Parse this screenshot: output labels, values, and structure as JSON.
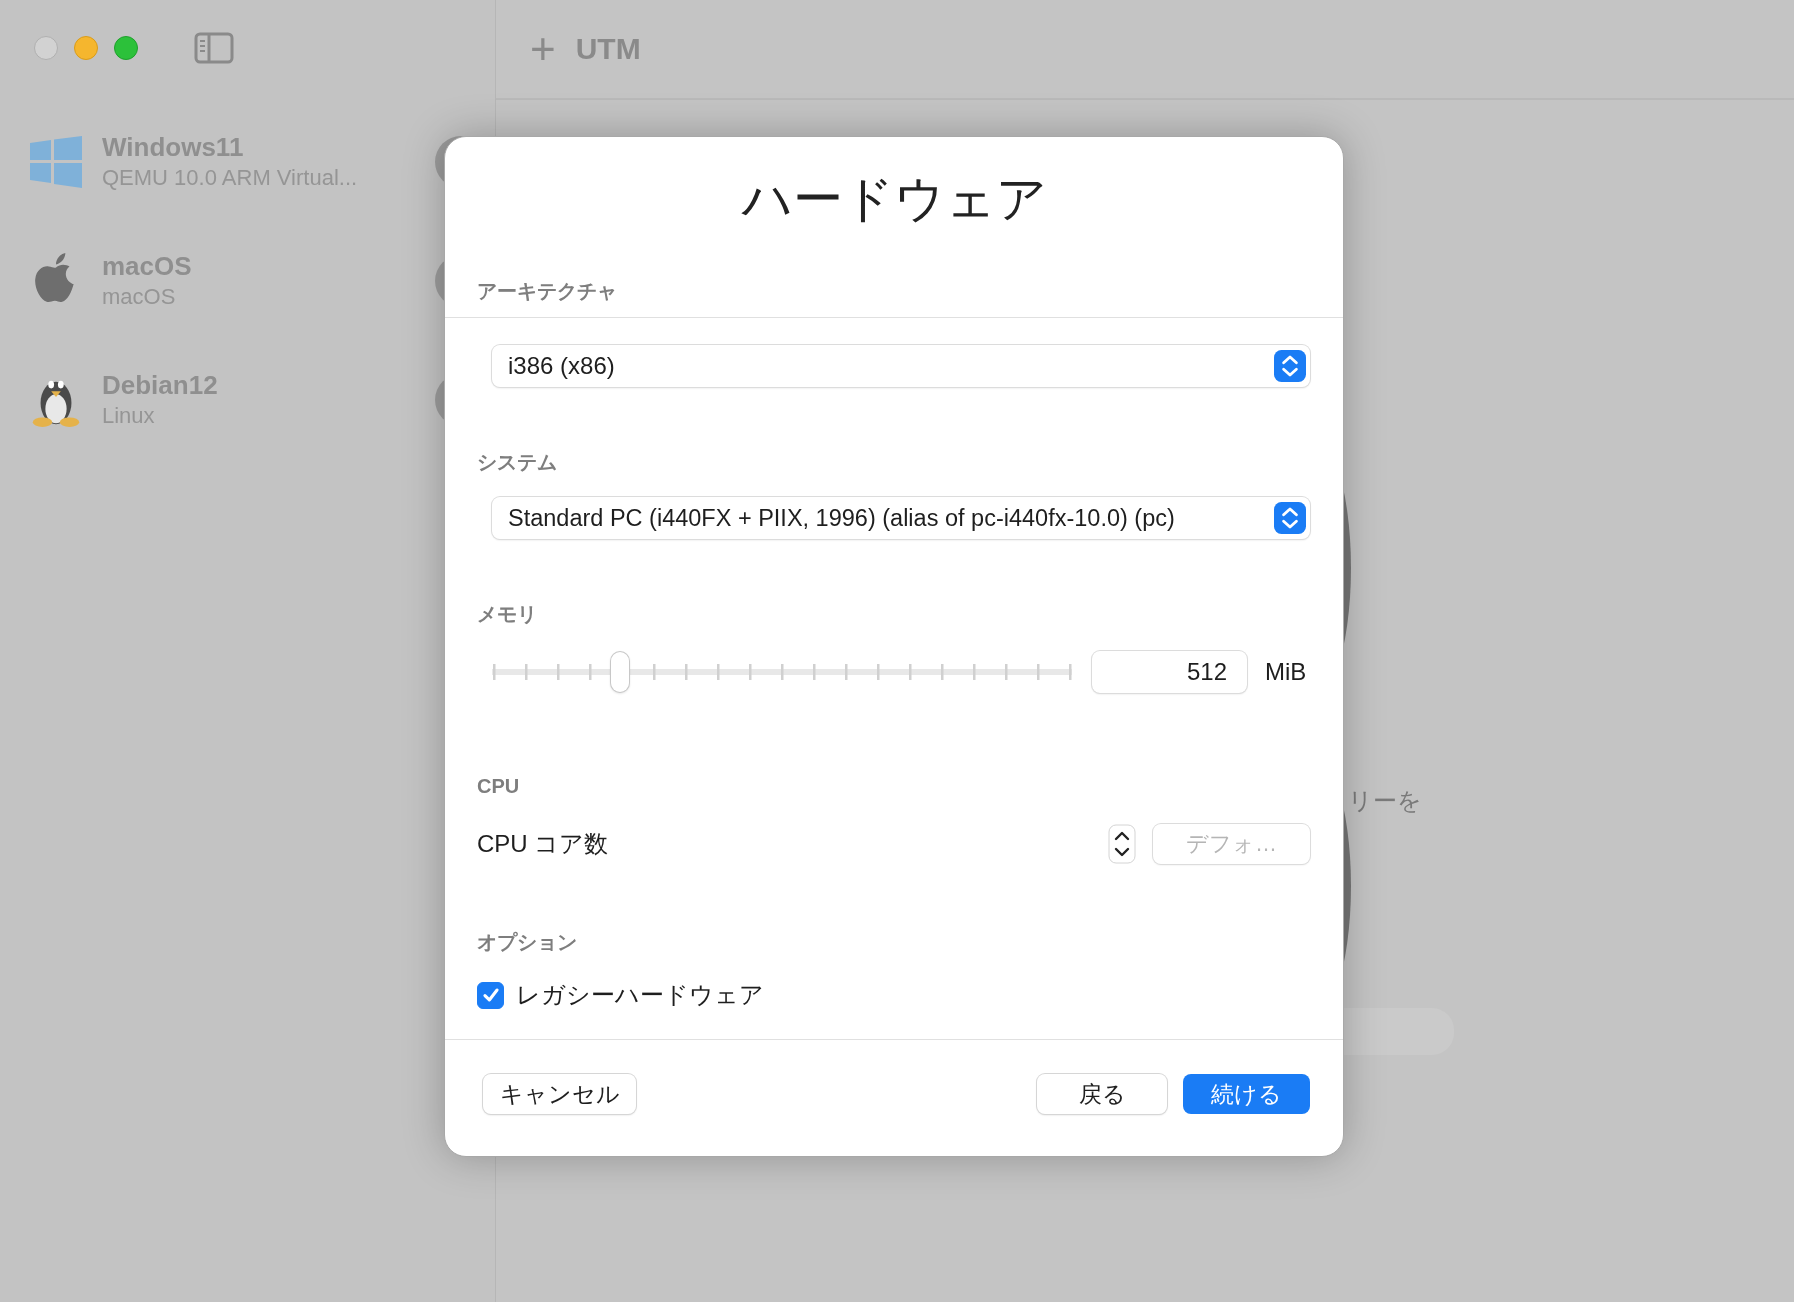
{
  "toolbar": {
    "add_button": "+",
    "title": "UTM"
  },
  "sidebar": {
    "items": [
      {
        "kind": "windows",
        "name": "Windows11",
        "subtitle": "QEMU 10.0 ARM Virtual..."
      },
      {
        "kind": "apple",
        "name": "macOS",
        "subtitle": "macOS"
      },
      {
        "kind": "linux",
        "name": "Debian12",
        "subtitle": "Linux"
      }
    ]
  },
  "background_cards": [
    {
      "kind": "circle",
      "caption": "リーを"
    },
    {
      "kind": "circle"
    },
    {
      "kind": "plain"
    }
  ],
  "dialog": {
    "title": "ハードウェア",
    "architecture": {
      "label": "アーキテクチャ",
      "value": "i386 (x86)"
    },
    "system": {
      "label": "システム",
      "value": "Standard PC (i440FX + PIIX, 1996) (alias of pc-i440fx-10.0) (pc)"
    },
    "memory": {
      "label": "メモリ",
      "level": 0.22,
      "value": "512",
      "unit": "MiB"
    },
    "cpu": {
      "label": "CPU",
      "field_label": "CPU コア数",
      "placeholder": "デフォ…"
    },
    "options": {
      "label": "オプション",
      "checkbox": {
        "label": "レガシーハードウェア",
        "checked": true
      }
    },
    "buttons": [
      {
        "kind": "default",
        "label": "キャンセル"
      },
      {
        "kind": "spacer"
      },
      {
        "kind": "default",
        "label": "戻る"
      },
      {
        "kind": "primary",
        "label": "続ける"
      }
    ]
  }
}
